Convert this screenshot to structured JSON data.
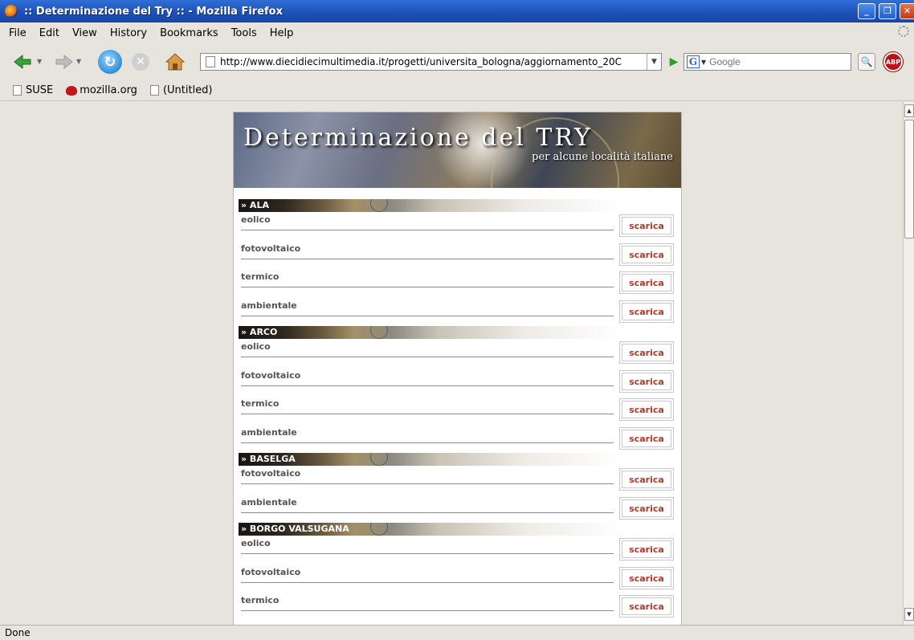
{
  "window": {
    "title": ":: Determinazione del Try :: - Mozilla Firefox"
  },
  "menu": [
    "File",
    "Edit",
    "View",
    "History",
    "Bookmarks",
    "Tools",
    "Help"
  ],
  "nav": {
    "url": "http://www.diecidiecimultimedia.it/progetti/universita_bologna/aggiornamento_20C",
    "search_placeholder": "Google",
    "abp_label": "ABP"
  },
  "bookmarks": [
    "SUSE",
    "mozilla.org",
    "(Untitled)"
  ],
  "page": {
    "title": "Determinazione del TRY",
    "subtitle": "per alcune località italiane"
  },
  "sections": [
    {
      "name": "» ALA",
      "items": [
        "eolico",
        "fotovoltaico",
        "termico",
        "ambientale"
      ]
    },
    {
      "name": "» ARCO",
      "items": [
        "eolico",
        "fotovoltaico",
        "termico",
        "ambientale"
      ]
    },
    {
      "name": "» BASELGA",
      "items": [
        "fotovoltaico",
        "ambientale"
      ]
    },
    {
      "name": "» BORGO VALSUGANA",
      "items": [
        "eolico",
        "fotovoltaico",
        "termico"
      ]
    }
  ],
  "button_label": "scarica",
  "status": "Done"
}
